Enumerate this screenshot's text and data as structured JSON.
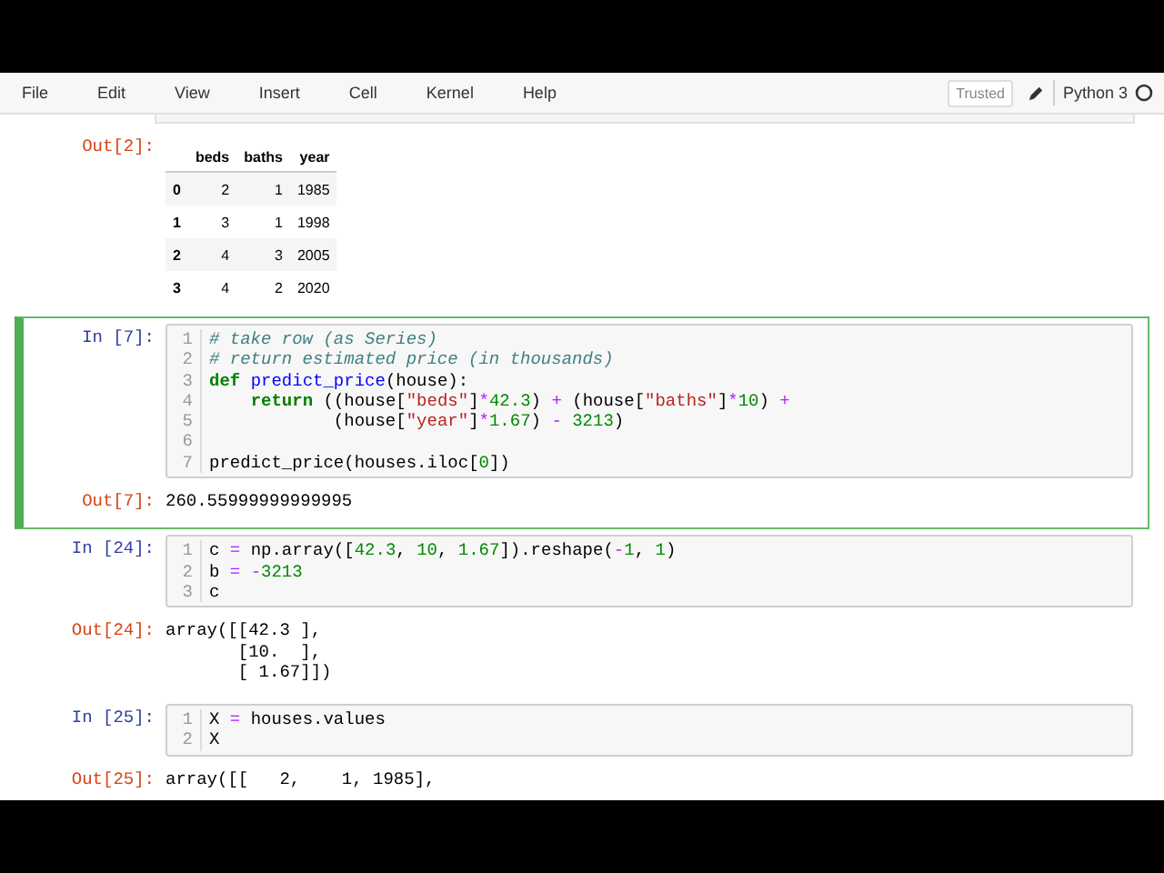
{
  "menu": {
    "items": [
      "File",
      "Edit",
      "View",
      "Insert",
      "Cell",
      "Kernel",
      "Help"
    ],
    "trusted": "Trusted",
    "kernel": "Python 3"
  },
  "cells": [
    {
      "kind": "table",
      "prompt": "Out[2]:",
      "columns": [
        "",
        "beds",
        "baths",
        "year"
      ],
      "rows": [
        [
          "0",
          "2",
          "1",
          "1985"
        ],
        [
          "1",
          "3",
          "1",
          "1998"
        ],
        [
          "2",
          "4",
          "3",
          "2005"
        ],
        [
          "3",
          "4",
          "2",
          "2020"
        ]
      ]
    },
    {
      "kind": "code",
      "selected": true,
      "prompt": "In [7]:",
      "lines": [
        {
          "number": "1",
          "code": "# take row (as Series)"
        },
        {
          "number": "2",
          "code": "# return estimated price (in thousands)"
        },
        {
          "number": "3",
          "code": "def predict_price(house):"
        },
        {
          "number": "4",
          "code": "    return ((house[\"beds\"]*42.3) + (house[\"baths\"]*10) +"
        },
        {
          "number": "5",
          "code": "            (house[\"year\"]*1.67) - 3213)"
        },
        {
          "number": "6"
        },
        {
          "number": "7",
          "code": "predict_price(houses.iloc[0])"
        }
      ],
      "output_prompt": "Out[7]:",
      "output": [
        "260.55999999999995"
      ]
    },
    {
      "kind": "code",
      "selected": false,
      "prompt": "In [24]:",
      "lines": [
        {
          "number": "1",
          "code": "c = np.array([42.3, 10, 1.67]).reshape(-1, 1)"
        },
        {
          "number": "2",
          "code": "b = -3213"
        },
        {
          "number": "3",
          "code": "c"
        }
      ],
      "output_prompt": "Out[24]:",
      "output": [
        "array([[42.3 ],",
        "       [10.  ],",
        "       [ 1.67]])"
      ]
    },
    {
      "kind": "code",
      "selected": false,
      "prompt": "In [25]:",
      "lines": [
        {
          "number": "1",
          "code": "X = houses.values"
        },
        {
          "number": "2",
          "code": "X"
        }
      ],
      "output_prompt": "Out[25]:",
      "output": [
        "array([[   2,    1, 1985],"
      ]
    }
  ]
}
